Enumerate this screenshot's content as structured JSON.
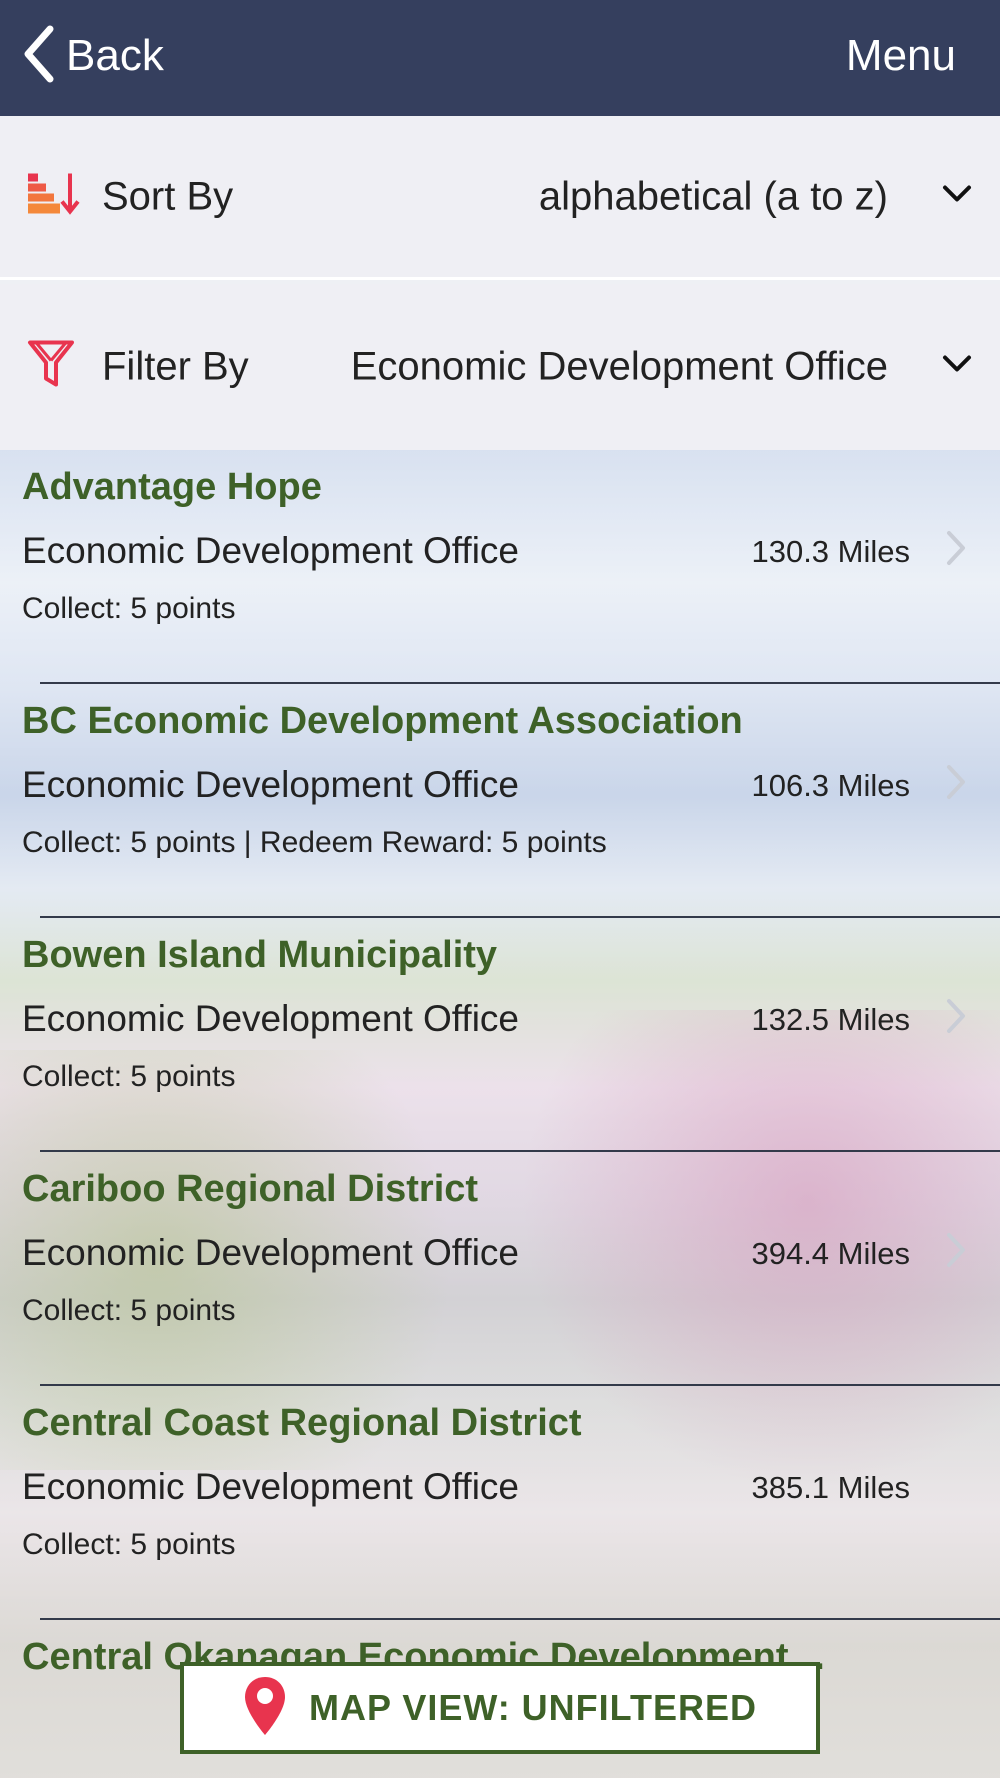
{
  "nav": {
    "back_label": "Back",
    "menu_label": "Menu"
  },
  "sort": {
    "label": "Sort By",
    "value": "alphabetical (a to z)"
  },
  "filter": {
    "label": "Filter By",
    "value": "Economic Development Office"
  },
  "items": [
    {
      "title": "Advantage Hope",
      "category": "Economic Development Office",
      "distance": "130.3 Miles",
      "points": "Collect: 5 points"
    },
    {
      "title": "BC Economic Development Association",
      "category": "Economic Development Office",
      "distance": "106.3 Miles",
      "points": "Collect: 5 points  |  Redeem Reward: 5 points"
    },
    {
      "title": "Bowen Island Municipality",
      "category": "Economic Development Office",
      "distance": "132.5 Miles",
      "points": "Collect: 5 points"
    },
    {
      "title": "Cariboo Regional District",
      "category": "Economic Development Office",
      "distance": "394.4 Miles",
      "points": "Collect: 5 points"
    },
    {
      "title": "Central Coast Regional District",
      "category": "Economic Development Office",
      "distance": "385.1 Miles",
      "points": "Collect: 5 points"
    },
    {
      "title": "Central Okanagan Economic Development…",
      "category": "",
      "distance": "",
      "points": ""
    }
  ],
  "map_button": {
    "label": "MAP VIEW: UNFILTERED"
  },
  "colors": {
    "nav_bg": "#353f5e",
    "title_green": "#3e6128",
    "accent_red": "#e8344e"
  },
  "icons": {
    "back": "chevron-left-icon",
    "sort": "sort-icon",
    "filter": "filter-icon",
    "dropdown": "chevron-down-icon",
    "row_chevron": "chevron-right-icon",
    "map": "map-pin-icon"
  }
}
